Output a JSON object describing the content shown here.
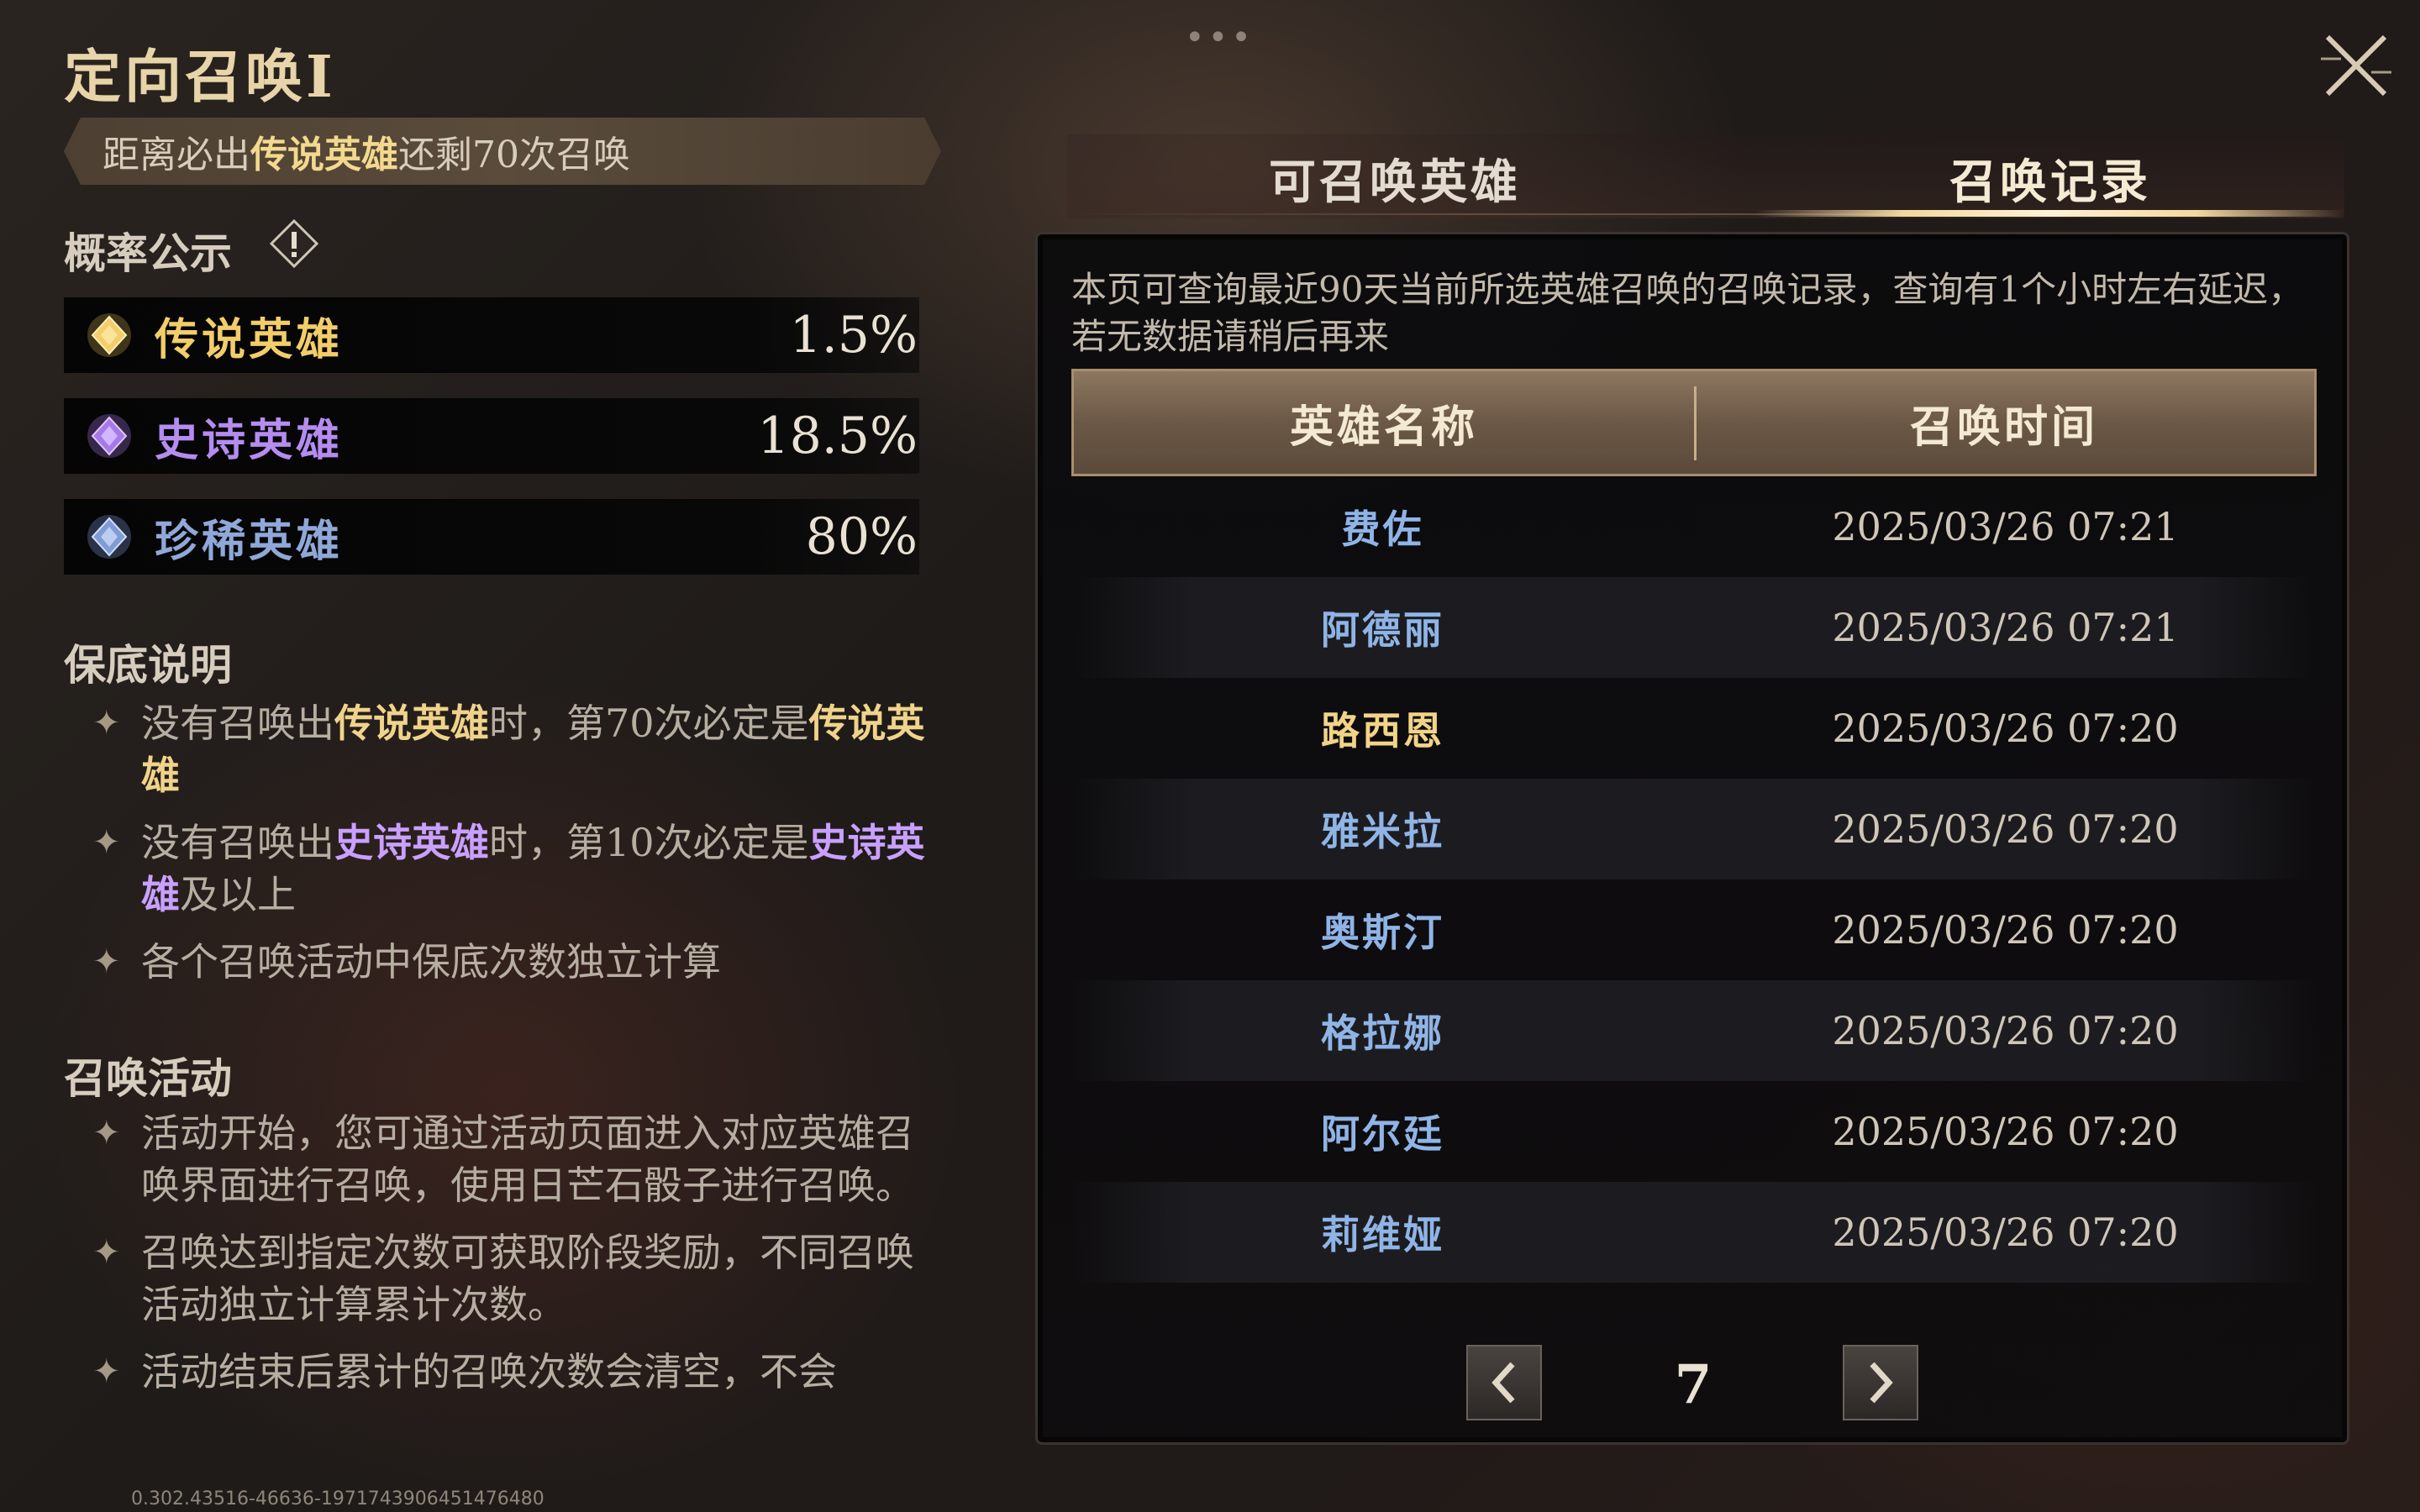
{
  "header": {
    "title": "定向召唤I",
    "handle_dots": "•••"
  },
  "pity": {
    "prefix": "距离必出",
    "highlight": "传说英雄",
    "suffix": "还剩70次召唤"
  },
  "rates": {
    "title": "概率公示",
    "items": [
      {
        "name": "传说英雄",
        "pct": "1.5%",
        "color": "#f2cd6a",
        "gem": "gold-gem-icon"
      },
      {
        "name": "史诗英雄",
        "pct": "18.5%",
        "color": "#b58cf0",
        "gem": "purple-gem-icon"
      },
      {
        "name": "珍稀英雄",
        "pct": "80%",
        "color": "#8fa8d8",
        "gem": "blue-gem-icon"
      }
    ]
  },
  "guarantee": {
    "title": "保底说明",
    "item1": {
      "a": "没有召唤出",
      "hl": "传说英雄",
      "b": "时，第70次必定是",
      "hl2": "传说英雄"
    },
    "item2": {
      "a": "没有召唤出",
      "hl": "史诗英雄",
      "b": "时，第10次必定是",
      "hl2": "史诗英雄",
      "c": "及以上"
    },
    "item3": "各个召唤活动中保底次数独立计算"
  },
  "activity": {
    "title": "召唤活动",
    "items": [
      "活动开始，您可通过活动页面进入对应英雄召唤界面进行召唤，使用日芒石骰子进行召唤。",
      "召唤达到指定次数可获取阶段奖励，不同召唤活动独立计算累计次数。",
      "活动结束后累计的召唤次数会清空，不会"
    ]
  },
  "version": "0.302.43516-46636-1971743906451476480",
  "tabs": {
    "available": "可召唤英雄",
    "history": "召唤记录",
    "active": "history"
  },
  "records": {
    "notice": "本页可查询最近90天当前所选英雄召唤的召唤记录，查询有1个小时左右延迟，若无数据请稍后再来",
    "col_name": "英雄名称",
    "col_time": "召唤时间",
    "rows": [
      {
        "hero": "费佐",
        "time": "2025/03/26 07:21",
        "color": "#8fb4e6"
      },
      {
        "hero": "阿德丽",
        "time": "2025/03/26 07:21",
        "color": "#8fb4e6"
      },
      {
        "hero": "路西恩",
        "time": "2025/03/26 07:20",
        "color": "#f2d488"
      },
      {
        "hero": "雅米拉",
        "time": "2025/03/26 07:20",
        "color": "#8fb4e6"
      },
      {
        "hero": "奥斯汀",
        "time": "2025/03/26 07:20",
        "color": "#8fb4e6"
      },
      {
        "hero": "格拉娜",
        "time": "2025/03/26 07:20",
        "color": "#8fb4e6"
      },
      {
        "hero": "阿尔廷",
        "time": "2025/03/26 07:20",
        "color": "#8fb4e6"
      },
      {
        "hero": "莉维娅",
        "time": "2025/03/26 07:20",
        "color": "#8fb4e6"
      }
    ],
    "page": "7"
  }
}
